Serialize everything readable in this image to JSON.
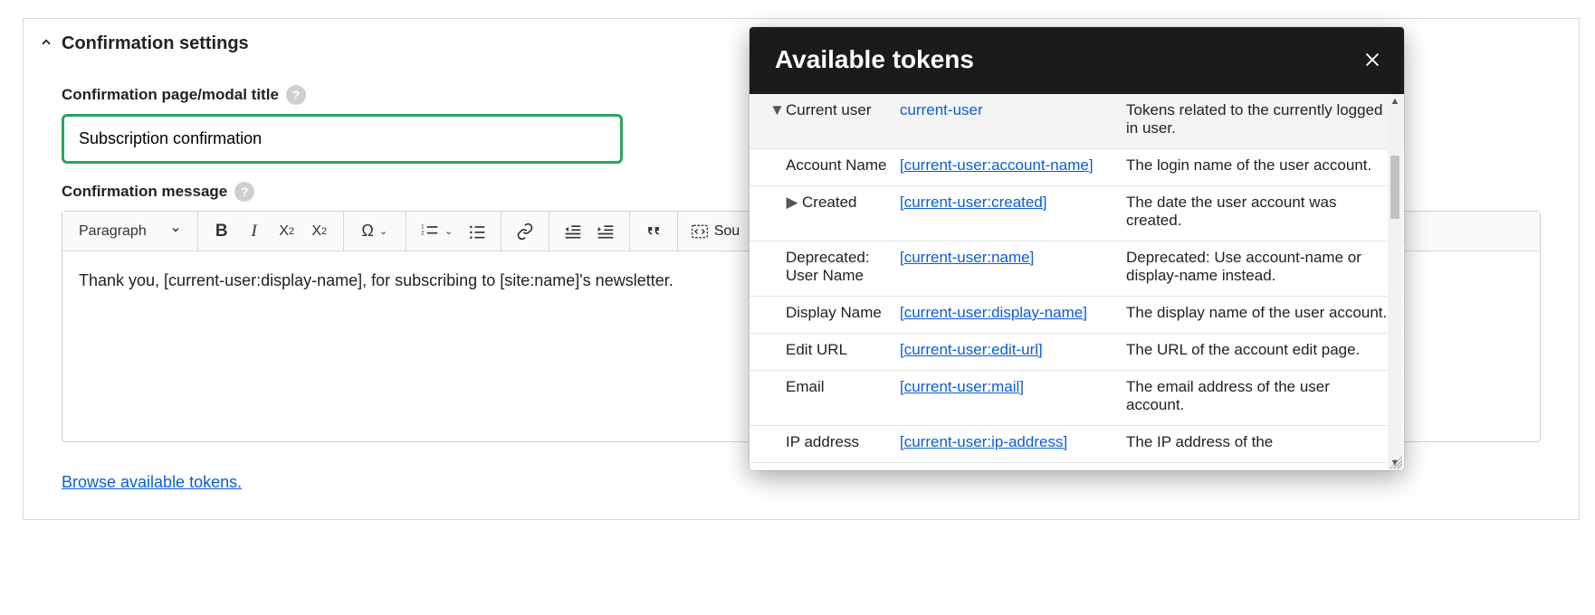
{
  "section": {
    "title": "Confirmation settings"
  },
  "fields": {
    "title_label": "Confirmation page/modal title",
    "title_value": "Subscription confirmation",
    "message_label": "Confirmation message",
    "message_value": "Thank you, [current-user:display-name], for subscribing to [site:name]'s newsletter."
  },
  "toolbar": {
    "format_label": "Paragraph",
    "source_label": "Sou"
  },
  "link": {
    "browse": "Browse available tokens."
  },
  "modal": {
    "title": "Available tokens"
  },
  "tokens": [
    {
      "name": "Current user",
      "indent": false,
      "expanded": true,
      "token": "current-user",
      "link_style": "nounder",
      "desc": "Tokens related to the currently logged in user."
    },
    {
      "name": "Account Name",
      "indent": true,
      "token": "[current-user:account-name]",
      "desc": "The login name of the user account."
    },
    {
      "name": "Created",
      "indent": true,
      "expandable": true,
      "token": "[current-user:created]",
      "desc": "The date the user account was created."
    },
    {
      "name": "Deprecated: User Name",
      "indent": true,
      "token": "[current-user:name]",
      "desc": "Deprecated: Use account-name or display-name instead."
    },
    {
      "name": "Display Name",
      "indent": true,
      "token": "[current-user:display-name]",
      "desc": "The display name of the user account."
    },
    {
      "name": "Edit URL",
      "indent": true,
      "token": "[current-user:edit-url]",
      "desc": "The URL of the account edit page."
    },
    {
      "name": "Email",
      "indent": true,
      "token": "[current-user:mail]",
      "desc": "The email address of the user account."
    },
    {
      "name": "IP address",
      "indent": true,
      "token": "[current-user:ip-address]",
      "desc": "The IP address of the"
    }
  ]
}
